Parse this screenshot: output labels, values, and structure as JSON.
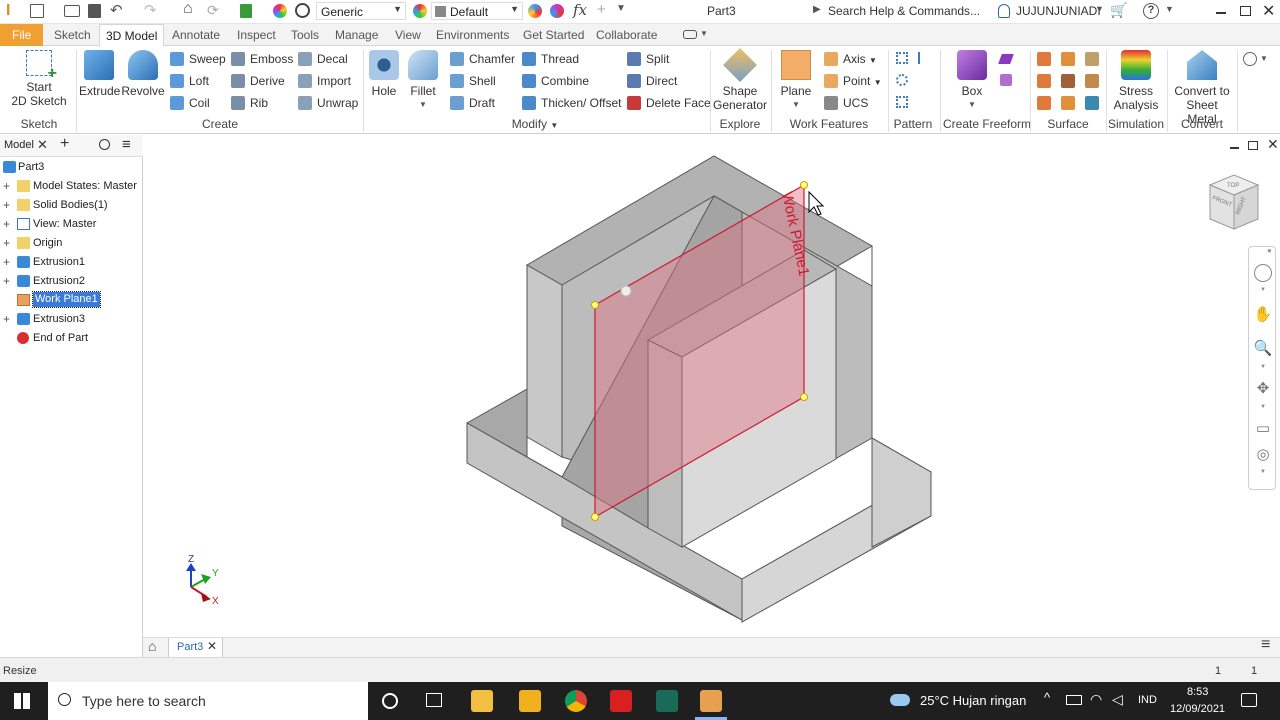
{
  "titlebar": {
    "material": "Generic",
    "appearance": "Default",
    "doc_title": "Part3",
    "search_placeholder": "Search Help & Commands...",
    "user": "JUJUNJUNIADI"
  },
  "tabs": [
    "File",
    "Sketch",
    "3D Model",
    "Annotate",
    "Inspect",
    "Tools",
    "Manage",
    "View",
    "Environments",
    "Get Started",
    "Collaborate"
  ],
  "active_tab": "3D Model",
  "ribbon": {
    "sketch": {
      "title": "Sketch",
      "start": "Start",
      "sketch2d": "2D Sketch"
    },
    "create": {
      "title": "Create",
      "extrude": "Extrude",
      "revolve": "Revolve",
      "sweep": "Sweep",
      "loft": "Loft",
      "coil": "Coil",
      "emboss": "Emboss",
      "derive": "Derive",
      "rib": "Rib",
      "decal": "Decal",
      "import": "Import",
      "unwrap": "Unwrap"
    },
    "modify": {
      "title": "Modify",
      "hole": "Hole",
      "fillet": "Fillet",
      "chamfer": "Chamfer",
      "shell": "Shell",
      "draft": "Draft",
      "thread": "Thread",
      "combine": "Combine",
      "thicken": "Thicken/ Offset",
      "split": "Split",
      "direct": "Direct",
      "delete_face": "Delete Face"
    },
    "explore": {
      "title": "Explore",
      "shape": "Shape",
      "generator": "Generator"
    },
    "work_features": {
      "title": "Work Features",
      "plane": "Plane",
      "axis": "Axis",
      "point": "Point",
      "ucs": "UCS"
    },
    "pattern": {
      "title": "Pattern"
    },
    "freeform": {
      "title": "Create Freeform",
      "box": "Box"
    },
    "surface": {
      "title": "Surface"
    },
    "simulation": {
      "title": "Simulation",
      "stress": "Stress",
      "analysis": "Analysis"
    },
    "convert": {
      "title": "Convert",
      "convert_to": "Convert to",
      "sheet_metal": "Sheet Metal"
    }
  },
  "browser": {
    "tab": "Model",
    "items": [
      {
        "label": "Part3",
        "expand": ""
      },
      {
        "label": "Model States: Master",
        "expand": "+"
      },
      {
        "label": "Solid Bodies(1)",
        "expand": "+"
      },
      {
        "label": "View: Master",
        "expand": "+"
      },
      {
        "label": "Origin",
        "expand": "+"
      },
      {
        "label": "Extrusion1",
        "expand": "+"
      },
      {
        "label": "Extrusion2",
        "expand": "+"
      },
      {
        "label": "Work Plane1",
        "expand": ""
      },
      {
        "label": "Extrusion3",
        "expand": "+"
      },
      {
        "label": "End of Part",
        "expand": ""
      }
    ]
  },
  "viewport": {
    "workplane_label": "Work Plane1",
    "viewcube": {
      "front": "FRONT",
      "top": "TOP",
      "right": "RIGHT"
    },
    "triad": {
      "x": "X",
      "y": "Y",
      "z": "Z"
    }
  },
  "doc_tab": "Part3",
  "status": {
    "left": "Resize",
    "count1": "1",
    "count2": "1"
  },
  "taskbar": {
    "search": "Type here to search",
    "weather": "25°C  Hujan ringan",
    "lang": "IND",
    "time": "8:53",
    "date": "12/09/2021"
  }
}
